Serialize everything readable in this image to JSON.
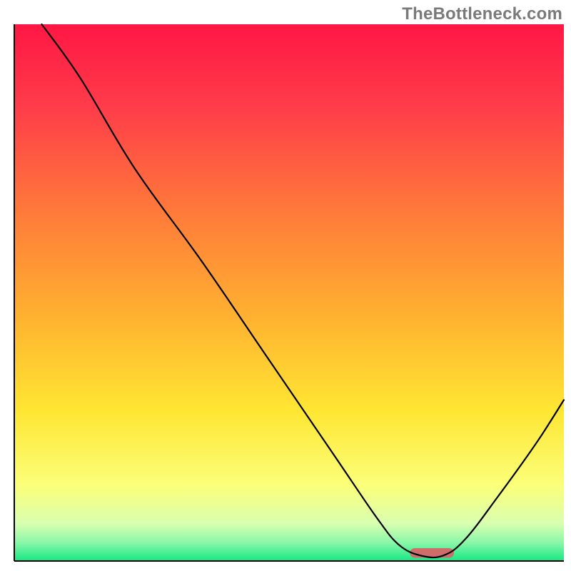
{
  "watermark": "TheBottleneck.com",
  "chart_data": {
    "type": "line",
    "title": "",
    "xlabel": "",
    "ylabel": "",
    "xlim": [
      0,
      100
    ],
    "ylim": [
      0,
      100
    ],
    "grid": false,
    "legend": false,
    "background": {
      "kind": "vertical-gradient",
      "stops": [
        {
          "pos": 0.0,
          "color": "#ff1744"
        },
        {
          "pos": 0.15,
          "color": "#ff3b4a"
        },
        {
          "pos": 0.35,
          "color": "#ff7a3a"
        },
        {
          "pos": 0.55,
          "color": "#ffb330"
        },
        {
          "pos": 0.72,
          "color": "#ffe633"
        },
        {
          "pos": 0.86,
          "color": "#fbff7a"
        },
        {
          "pos": 0.93,
          "color": "#d9ffb0"
        },
        {
          "pos": 0.965,
          "color": "#8cf7a9"
        },
        {
          "pos": 1.0,
          "color": "#17e884"
        }
      ]
    },
    "series": [
      {
        "name": "curve",
        "color": "#000000",
        "x": [
          5,
          12,
          22,
          34,
          46,
          58,
          66,
          70,
          74,
          78,
          82,
          88,
          95,
          100
        ],
        "y": [
          100,
          90,
          73,
          56,
          38,
          20,
          8,
          3,
          1,
          1,
          4,
          12,
          22,
          30
        ]
      }
    ],
    "annotations": [
      {
        "name": "min-marker",
        "shape": "capsule",
        "x_center": 76,
        "y_center": 1.5,
        "width": 8,
        "height": 1.8,
        "color": "#cf6d6b"
      }
    ]
  }
}
